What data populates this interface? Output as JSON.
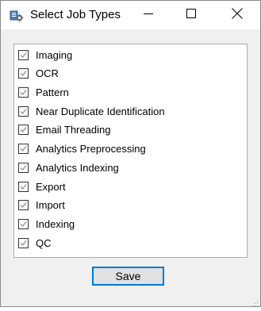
{
  "window": {
    "title": "Select Job Types",
    "app_icon": "job-types-app-icon",
    "controls": {
      "minimize_icon": "minimize-icon",
      "maximize_icon": "maximize-icon",
      "close_icon": "close-icon"
    }
  },
  "job_types": [
    {
      "label": "Imaging",
      "checked": true
    },
    {
      "label": "OCR",
      "checked": true
    },
    {
      "label": "Pattern",
      "checked": true
    },
    {
      "label": "Near Duplicate Identification",
      "checked": true
    },
    {
      "label": "Email Threading",
      "checked": true
    },
    {
      "label": "Analytics Preprocessing",
      "checked": true
    },
    {
      "label": "Analytics Indexing",
      "checked": true
    },
    {
      "label": "Export",
      "checked": true
    },
    {
      "label": "Import",
      "checked": true
    },
    {
      "label": "Indexing",
      "checked": true
    },
    {
      "label": "QC",
      "checked": true
    }
  ],
  "footer": {
    "save_label": "Save"
  },
  "colors": {
    "checkmark": "#a0a0a0",
    "focus_border": "#0078d7",
    "button_bg": "#e1e1e1"
  }
}
